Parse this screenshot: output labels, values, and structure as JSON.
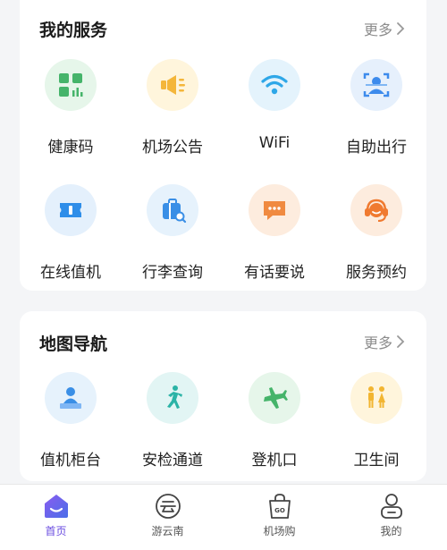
{
  "services": {
    "title": "我的服务",
    "more": "更多",
    "items": [
      {
        "label": "健康码",
        "icon": "health-code-icon",
        "bg": "#e6f6ea",
        "color": "#45b46a"
      },
      {
        "label": "机场公告",
        "icon": "megaphone-icon",
        "bg": "#fff5dc",
        "color": "#f4b63a"
      },
      {
        "label": "WiFi",
        "icon": "wifi-icon",
        "bg": "#e4f3fc",
        "color": "#2ea7e8"
      },
      {
        "label": "自助出行",
        "icon": "face-scan-icon",
        "bg": "#e6f0fc",
        "color": "#3d8bec"
      },
      {
        "label": "在线值机",
        "icon": "ticket-icon",
        "bg": "#e4f0fc",
        "color": "#2f8ee9"
      },
      {
        "label": "行李查询",
        "icon": "luggage-search-icon",
        "bg": "#e6f2fc",
        "color": "#3a8fe6"
      },
      {
        "label": "有话要说",
        "icon": "chat-icon",
        "bg": "#fdecde",
        "color": "#f08a40"
      },
      {
        "label": "服务预约",
        "icon": "headset-icon",
        "bg": "#fdecde",
        "color": "#f07a30"
      }
    ]
  },
  "map_nav": {
    "title": "地图导航",
    "more": "更多",
    "items": [
      {
        "label": "值机柜台",
        "icon": "check-in-counter-icon",
        "bg": "#e6f2fc",
        "color": "#3a8fe6"
      },
      {
        "label": "安检通道",
        "icon": "running-person-icon",
        "bg": "#e2f5f4",
        "color": "#2bb3a6"
      },
      {
        "label": "登机口",
        "icon": "airplane-icon",
        "bg": "#e6f6ea",
        "color": "#45b46a"
      },
      {
        "label": "卫生间",
        "icon": "restroom-icon",
        "bg": "#fff5dc",
        "color": "#f2b531"
      }
    ]
  },
  "tabbar": {
    "items": [
      {
        "label": "首页",
        "icon": "home-icon",
        "active": true
      },
      {
        "label": "游云南",
        "icon": "yunnan-icon",
        "active": false
      },
      {
        "label": "机场购",
        "icon": "shopping-bag-icon",
        "active": false
      },
      {
        "label": "我的",
        "icon": "profile-icon",
        "active": false
      }
    ]
  },
  "colors": {
    "accent": "#6a4ce0",
    "muted": "#8c8c8c"
  }
}
